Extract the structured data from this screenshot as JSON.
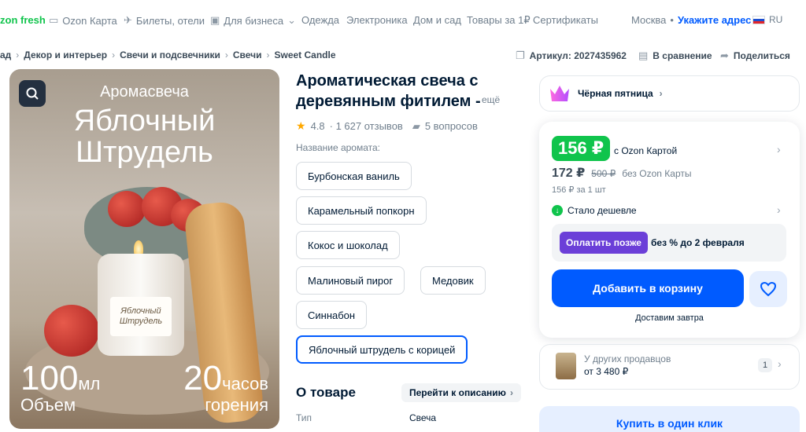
{
  "topnav": {
    "fresh": "zon fresh",
    "map": "Ozon Карта",
    "tickets": "Билеты, отели",
    "business": "Для бизнеса",
    "cat1": "Одежда",
    "cat2": "Электроника",
    "cat3": "Дом и сад",
    "cat4": "Товары за 1₽",
    "cat5": "Сертификаты",
    "city": "Москва",
    "address": "Укажите адрес",
    "lang": "RU"
  },
  "breadcrumb": {
    "items": [
      "ад",
      "Декор и интерьер",
      "Свечи и подсвечники",
      "Свечи",
      "Sweet Candle"
    ],
    "separator": "›"
  },
  "meta": {
    "sku": "Артикул: 2027435962",
    "compare": "В сравнение",
    "share": "Поделиться"
  },
  "image": {
    "line1": "Аромасвеча",
    "line2": "Яблочный",
    "line3": "Штрудель",
    "jar_label": "Яблочный Штрудель",
    "volume_num": "100",
    "volume_unit": "мл",
    "volume_caption": "Объем",
    "hours_num": "20",
    "hours_unit": "часов",
    "hours_caption": "горения"
  },
  "product": {
    "title": "Ароматическая свеча с деревянным фитилем -",
    "more": "ещё",
    "rating": "4.8",
    "reviews": "· 1 627 отзывов",
    "questions": "5 вопросов",
    "scent_label": "Название аромата:",
    "scents": [
      "Бурбонская ваниль",
      "Карамельный попкорн",
      "Кокос и шоколад",
      "Малиновый пирог",
      "Медовик",
      "Синнабон",
      "Яблочный штрудель с корицей"
    ],
    "about": "О товаре",
    "goto_desc": "Перейти к описанию",
    "spec_key": "Тип",
    "spec_val": "Свеча"
  },
  "buy": {
    "promo": "Чёрная пятница",
    "card_price": "156 ₽",
    "with_card": "с Ozon Картой",
    "price": "172 ₽",
    "old_price": "500 ₽",
    "no_card": "без Ozon Карты",
    "per_unit": "156 ₽ за 1 шт",
    "cheaper": "Стало дешевле",
    "pay_later": "Оплатить позже",
    "pay_later_text": "без % до 2 февраля",
    "add_to_cart": "Добавить в корзину",
    "delivery": "Доставим завтра",
    "other_sellers": "У других продавцов",
    "other_price": "от 3 480 ₽",
    "other_count": "1",
    "one_click": "Купить в один клик"
  },
  "colors": {
    "brand_blue": "#005bff",
    "green": "#10c44c",
    "purple": "#6b3fd8"
  }
}
